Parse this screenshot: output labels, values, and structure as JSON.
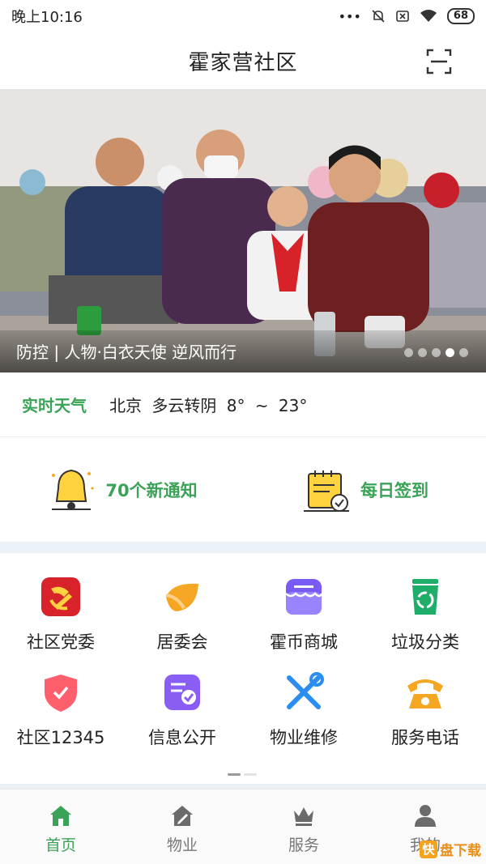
{
  "status_bar": {
    "time": "晚上10:16",
    "battery": "68"
  },
  "header": {
    "title": "霍家营社区"
  },
  "banner": {
    "caption": "防控 | 人物·白衣天使 逆风而行",
    "slide_count": 5,
    "active_slide": 4
  },
  "weather": {
    "label": "实时天气",
    "info": "北京  多云转阴  8° ~ 23°"
  },
  "notices": [
    {
      "label": "70个新通知",
      "icon": "bell-icon"
    },
    {
      "label": "每日签到",
      "icon": "calendar-checkin-icon"
    }
  ],
  "services": [
    {
      "label": "社区党委",
      "icon": "party-emblem-icon"
    },
    {
      "label": "居委会",
      "icon": "leaf-icon"
    },
    {
      "label": "霍币商城",
      "icon": "store-icon"
    },
    {
      "label": "垃圾分类",
      "icon": "recycle-bin-icon"
    },
    {
      "label": "社区12345",
      "icon": "shield-heart-icon"
    },
    {
      "label": "信息公开",
      "icon": "document-check-icon"
    },
    {
      "label": "物业维修",
      "icon": "tools-icon"
    },
    {
      "label": "服务电话",
      "icon": "telephone-icon"
    }
  ],
  "tabs": [
    {
      "label": "首页",
      "icon": "home-icon",
      "active": true
    },
    {
      "label": "物业",
      "icon": "house-edit-icon",
      "active": false
    },
    {
      "label": "服务",
      "icon": "crown-icon",
      "active": false
    },
    {
      "label": "我的",
      "icon": "user-icon",
      "active": false
    }
  ],
  "watermark": {
    "badge": "快",
    "text": "盘下载"
  },
  "colors": {
    "accent": "#3aa357",
    "strip": "#eaf1f7"
  }
}
